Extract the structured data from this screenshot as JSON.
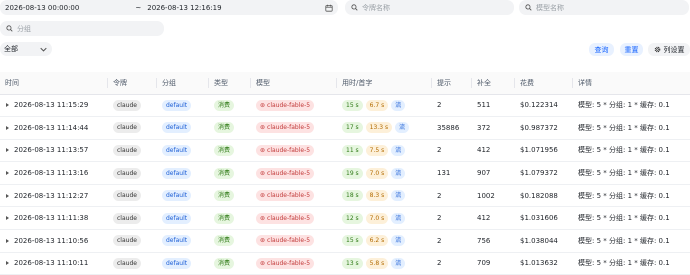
{
  "filters": {
    "date_start": "2026-08-13 00:00:00",
    "date_sep": "~",
    "date_end": "2026-08-13 12:16:19",
    "token_placeholder": "令牌名称",
    "model_placeholder": "模型名称",
    "group_placeholder": "分组",
    "select_value": "全部"
  },
  "actions": {
    "query": "查询",
    "reset": "重置",
    "columns": "列设置"
  },
  "columns": [
    "时间",
    "令牌",
    "分组",
    "类型",
    "模型",
    "用时/首字",
    "提示",
    "补全",
    "花费",
    "详情"
  ],
  "rows": [
    {
      "time": "2026-08-13 11:15:29",
      "token": "claude",
      "group": "default",
      "type": "消费",
      "model": "claude-fable-5",
      "use_time": "15 s",
      "first_token": "6.7 s",
      "stream": "流",
      "prompt": "2",
      "completion": "511",
      "cost": "$0.122314",
      "detail": "模型: 5 * 分组: 1 * 缓存: 0.1"
    },
    {
      "time": "2026-08-13 11:14:44",
      "token": "claude",
      "group": "default",
      "type": "消费",
      "model": "claude-fable-5",
      "use_time": "17 s",
      "first_token": "13.3 s",
      "stream": "流",
      "prompt": "35886",
      "completion": "372",
      "cost": "$0.987372",
      "detail": "模型: 5 * 分组: 1 * 缓存: 0.1"
    },
    {
      "time": "2026-08-13 11:13:57",
      "token": "claude",
      "group": "default",
      "type": "消费",
      "model": "claude-fable-5",
      "use_time": "11 s",
      "first_token": "7.5 s",
      "stream": "流",
      "prompt": "2",
      "completion": "412",
      "cost": "$1.071956",
      "detail": "模型: 5 * 分组: 1 * 缓存: 0.1"
    },
    {
      "time": "2026-08-13 11:13:16",
      "token": "claude",
      "group": "default",
      "type": "消费",
      "model": "claude-fable-5",
      "use_time": "19 s",
      "first_token": "7.0 s",
      "stream": "流",
      "prompt": "131",
      "completion": "907",
      "cost": "$1.079372",
      "detail": "模型: 5 * 分组: 1 * 缓存: 0.1"
    },
    {
      "time": "2026-08-13 11:12:27",
      "token": "claude",
      "group": "default",
      "type": "消费",
      "model": "claude-fable-5",
      "use_time": "18 s",
      "first_token": "8.3 s",
      "stream": "流",
      "prompt": "2",
      "completion": "1002",
      "cost": "$0.182088",
      "detail": "模型: 5 * 分组: 1 * 缓存: 0.1"
    },
    {
      "time": "2026-08-13 11:11:38",
      "token": "claude",
      "group": "default",
      "type": "消费",
      "model": "claude-fable-5",
      "use_time": "12 s",
      "first_token": "7.0 s",
      "stream": "流",
      "prompt": "2",
      "completion": "412",
      "cost": "$1.031606",
      "detail": "模型: 5 * 分组: 1 * 缓存: 0.1"
    },
    {
      "time": "2026-08-13 11:10:56",
      "token": "claude",
      "group": "default",
      "type": "消费",
      "model": "claude-fable-5",
      "use_time": "15 s",
      "first_token": "6.2 s",
      "stream": "流",
      "prompt": "2",
      "completion": "756",
      "cost": "$1.038044",
      "detail": "模型: 5 * 分组: 1 * 缓存: 0.1"
    },
    {
      "time": "2026-08-13 11:10:11",
      "token": "claude",
      "group": "default",
      "type": "消费",
      "model": "claude-fable-5",
      "use_time": "13 s",
      "first_token": "5.8 s",
      "stream": "流",
      "prompt": "2",
      "completion": "709",
      "cost": "$1.013632",
      "detail": "模型: 5 * 分组: 1 * 缓存: 0.1"
    }
  ],
  "icons": {
    "calendar": "calendar-icon",
    "search": "search-icon",
    "chevron": "chevron-down-icon",
    "gear": "gear-icon",
    "expand": "caret-right-icon",
    "model_tag": "bullet-icon"
  }
}
